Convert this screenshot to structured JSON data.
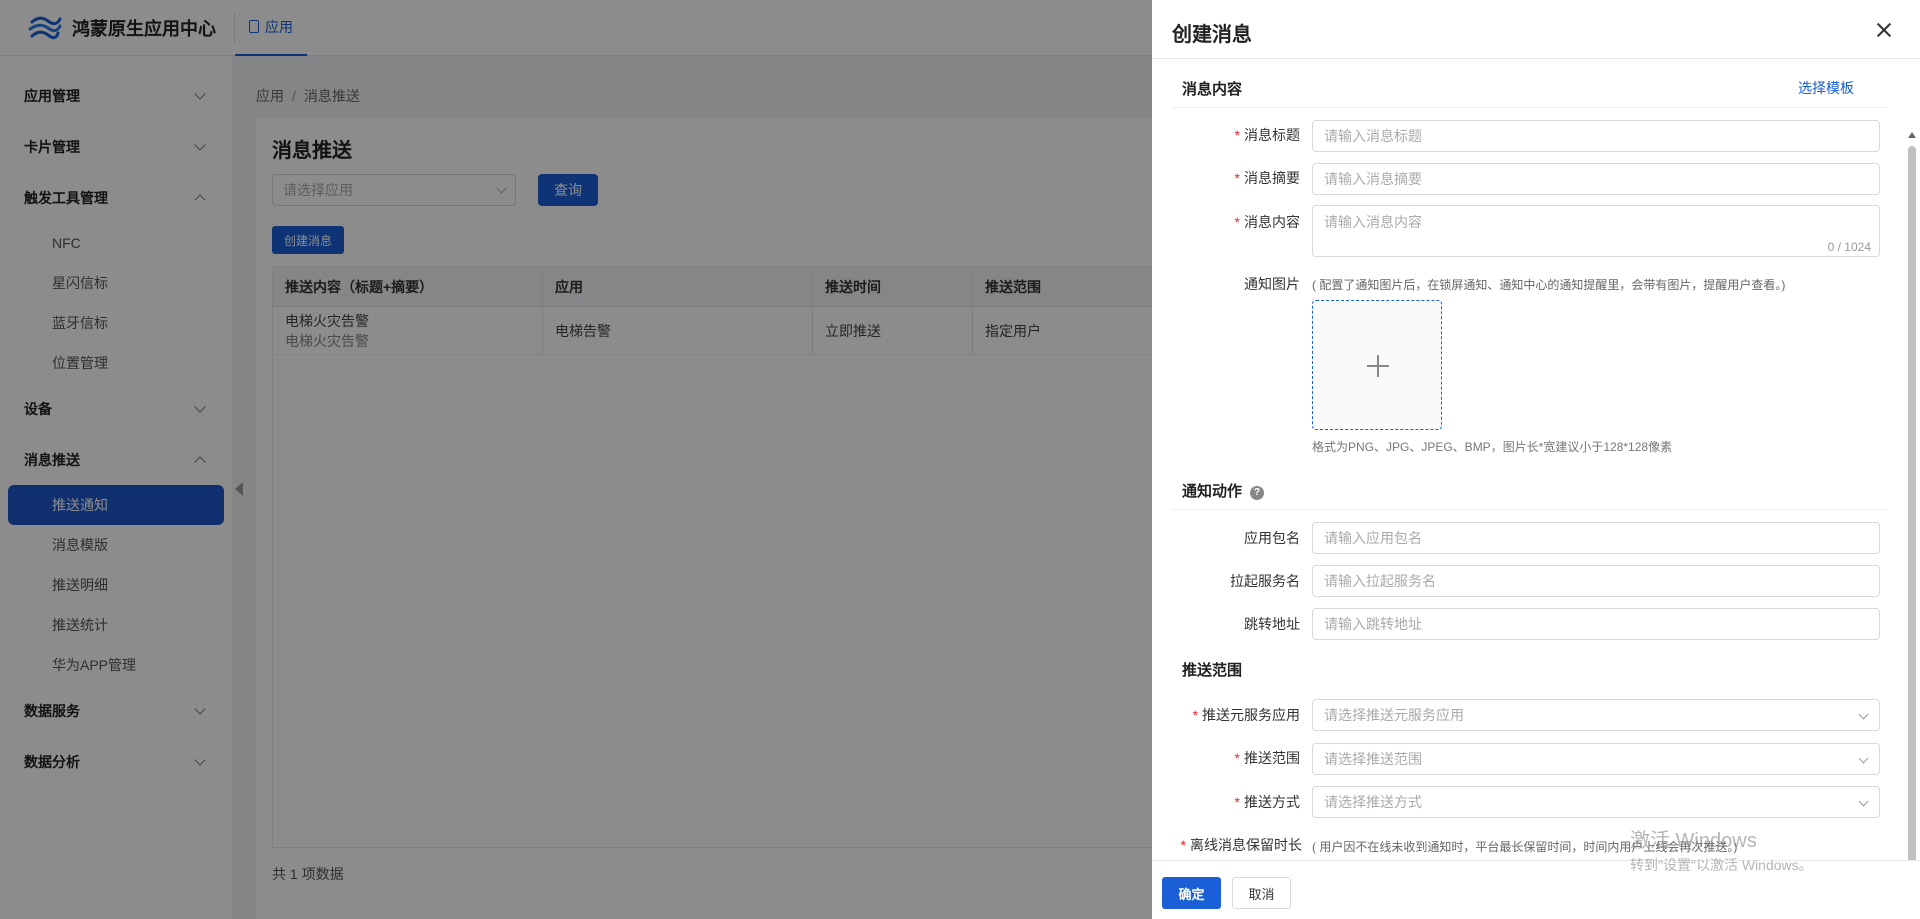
{
  "header": {
    "app_title": "鸿蒙原生应用中心",
    "nav_tab": "应用"
  },
  "sidebar": {
    "groups": [
      {
        "label": "应用管理",
        "expanded": false
      },
      {
        "label": "卡片管理",
        "expanded": false
      },
      {
        "label": "触发工具管理",
        "expanded": true,
        "items": [
          "NFC",
          "星闪信标",
          "蓝牙信标",
          "位置管理"
        ]
      },
      {
        "label": "设备",
        "expanded": false
      },
      {
        "label": "消息推送",
        "expanded": true,
        "items": [
          "推送通知",
          "消息模版",
          "推送明细",
          "推送统计",
          "华为APP管理"
        ]
      },
      {
        "label": "数据服务",
        "expanded": false
      },
      {
        "label": "数据分析",
        "expanded": false
      }
    ],
    "active_item": "推送通知"
  },
  "breadcrumb": [
    "应用",
    "消息推送"
  ],
  "page": {
    "title": "消息推送",
    "app_select_placeholder": "请选择应用",
    "query_label": "查询",
    "create_label": "创建消息",
    "table": {
      "columns": [
        "推送内容（标题+摘要）",
        "应用",
        "推送时间",
        "推送范围"
      ],
      "rows": [
        {
          "title": "电梯火灾告警",
          "summary": "电梯火灾告警",
          "app": "电梯告警",
          "time": "立即推送",
          "scope": "指定用户"
        }
      ]
    },
    "total": "共 1 项数据"
  },
  "drawer": {
    "title": "创建消息",
    "sections": {
      "content": "消息内容",
      "action": "通知动作",
      "scope": "推送范围"
    },
    "select_template": "选择模板",
    "fields": {
      "msg_title": {
        "label": "消息标题",
        "placeholder": "请输入消息标题"
      },
      "msg_summary": {
        "label": "消息摘要",
        "placeholder": "请输入消息摘要"
      },
      "msg_content": {
        "label": "消息内容",
        "placeholder": "请输入消息内容",
        "counter": "0 / 1024"
      },
      "notify_image": {
        "label": "通知图片",
        "hint": "( 配置了通知图片后，在锁屏通知、通知中心的通知提醒里，会带有图片，提醒用户查看。)",
        "format_hint": "格式为PNG、JPG、JPEG、BMP，图片长*宽建议小于128*128像素"
      },
      "package_name": {
        "label": "应用包名",
        "placeholder": "请输入应用包名"
      },
      "service_name": {
        "label": "拉起服务名",
        "placeholder": "请输入拉起服务名"
      },
      "jump_url": {
        "label": "跳转地址",
        "placeholder": "请输入跳转地址"
      },
      "meta_app": {
        "label": "推送元服务应用",
        "placeholder": "请选择推送元服务应用"
      },
      "push_scope": {
        "label": "推送范围",
        "placeholder": "请选择推送范围"
      },
      "push_mode": {
        "label": "推送方式",
        "placeholder": "请选择推送方式"
      },
      "offline_keep": {
        "label": "离线消息保留时长",
        "hint": "( 用户因不在线未收到通知时，平台最长保留时间，时间内用户上线会再次推送。)"
      }
    },
    "ok_label": "确定",
    "cancel_label": "取消"
  },
  "watermark": {
    "line1": "激活 Windows",
    "line2": "转到\"设置\"以激活 Windows。"
  },
  "colors": {
    "primary": "#1a5fd6",
    "required": "#f5222d"
  }
}
